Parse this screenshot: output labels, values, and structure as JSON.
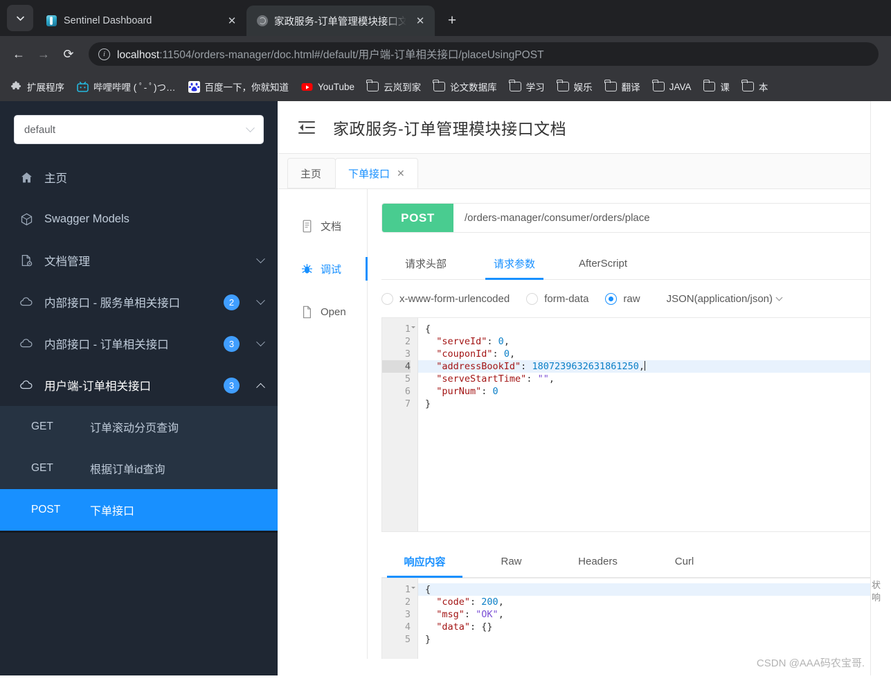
{
  "browser": {
    "tabs": [
      {
        "title": "Sentinel Dashboard",
        "favicon": "sentinel-icon",
        "active": false
      },
      {
        "title": "家政服务-订单管理模块接口文档",
        "favicon": "globe-icon",
        "active": true
      }
    ],
    "new_tab_label": "+",
    "close_label": "✕",
    "nav": {
      "back": "←",
      "forward": "→",
      "reload": "⟳"
    },
    "omnibox": {
      "info_icon_label": "i",
      "url_host": "localhost",
      "url_rest": ":11504/orders-manager/doc.html#/default/用户端-订单相关接口/placeUsingPOST"
    },
    "bookmarks": [
      {
        "label": "扩展程序",
        "icon": "puzzle-icon"
      },
      {
        "label": "哔哩哔哩 ( ﾟ- ﾟ)つ…",
        "icon": "bilibili-icon"
      },
      {
        "label": "百度一下，你就知道",
        "icon": "baidu-icon"
      },
      {
        "label": "YouTube",
        "icon": "youtube-icon"
      },
      {
        "label": "云岚到家",
        "icon": "folder-icon"
      },
      {
        "label": "论文数据库",
        "icon": "folder-icon"
      },
      {
        "label": "学习",
        "icon": "folder-icon"
      },
      {
        "label": "娱乐",
        "icon": "folder-icon"
      },
      {
        "label": "翻译",
        "icon": "folder-icon"
      },
      {
        "label": "JAVA",
        "icon": "folder-icon"
      },
      {
        "label": "课",
        "icon": "folder-icon"
      },
      {
        "label": "本",
        "icon": "folder-icon"
      }
    ]
  },
  "sidebar": {
    "selector_value": "default",
    "menu": [
      {
        "label": "主页",
        "icon": "home-icon",
        "badge": "",
        "arrow": ""
      },
      {
        "label": "Swagger Models",
        "icon": "cube-icon",
        "badge": "",
        "arrow": ""
      },
      {
        "label": "文档管理",
        "icon": "doc-gear-icon",
        "badge": "",
        "arrow": "down"
      },
      {
        "label": "内部接口 - 服务单相关接口",
        "icon": "cloud-icon",
        "badge": "2",
        "arrow": "down"
      },
      {
        "label": "内部接口 - 订单相关接口",
        "icon": "cloud-icon",
        "badge": "3",
        "arrow": "down"
      },
      {
        "label": "用户端-订单相关接口",
        "icon": "cloud-icon",
        "badge": "3",
        "arrow": "up"
      }
    ],
    "submenu": [
      {
        "method": "GET",
        "label": "订单滚动分页查询",
        "active": false
      },
      {
        "method": "GET",
        "label": "根据订单id查询",
        "active": false
      },
      {
        "method": "POST",
        "label": "下单接口",
        "active": true
      }
    ]
  },
  "doc": {
    "title": "家政服务-订单管理模块接口文档",
    "collapse_icon": "collapse-menu-icon",
    "page_tabs": [
      {
        "label": "主页",
        "closable": false,
        "active": false
      },
      {
        "label": "下单接口",
        "closable": true,
        "active": true
      }
    ],
    "close_glyph": "✕",
    "vtabs": [
      {
        "label": "文档",
        "icon": "document-icon",
        "active": false
      },
      {
        "label": "调试",
        "icon": "bug-icon",
        "active": true
      },
      {
        "label": "Open",
        "icon": "file-icon",
        "active": false
      }
    ],
    "request": {
      "method": "POST",
      "url": "/orders-manager/consumer/orders/place",
      "sub_tabs": [
        {
          "label": "请求头部",
          "active": false
        },
        {
          "label": "请求参数",
          "active": true
        },
        {
          "label": "AfterScript",
          "active": false
        }
      ],
      "body_types": [
        {
          "label": "x-www-form-urlencoded",
          "selected": false
        },
        {
          "label": "form-data",
          "selected": false
        },
        {
          "label": "raw",
          "selected": true
        }
      ],
      "content_type": "JSON(application/json)",
      "editor_lines": [
        {
          "no": "1",
          "fold": true,
          "current": false,
          "highlight": false,
          "tokens": [
            {
              "t": "{",
              "c": "pun"
            }
          ]
        },
        {
          "no": "2",
          "fold": false,
          "current": false,
          "highlight": false,
          "tokens": [
            {
              "t": "  \"serveId\"",
              "c": "k"
            },
            {
              "t": ": ",
              "c": "pun"
            },
            {
              "t": "0",
              "c": "num"
            },
            {
              "t": ",",
              "c": "pun"
            }
          ]
        },
        {
          "no": "3",
          "fold": false,
          "current": false,
          "highlight": false,
          "tokens": [
            {
              "t": "  \"couponId\"",
              "c": "k"
            },
            {
              "t": ": ",
              "c": "pun"
            },
            {
              "t": "0",
              "c": "num"
            },
            {
              "t": ",",
              "c": "pun"
            }
          ]
        },
        {
          "no": "4",
          "fold": false,
          "current": true,
          "highlight": true,
          "tokens": [
            {
              "t": "  \"addressBookId\"",
              "c": "k"
            },
            {
              "t": ": ",
              "c": "pun"
            },
            {
              "t": "1807239632631861250",
              "c": "num"
            },
            {
              "t": ",",
              "c": "pun"
            }
          ]
        },
        {
          "no": "5",
          "fold": false,
          "current": false,
          "highlight": false,
          "tokens": [
            {
              "t": "  \"serveStartTime\"",
              "c": "k"
            },
            {
              "t": ": ",
              "c": "pun"
            },
            {
              "t": "\"\"",
              "c": "str"
            },
            {
              "t": ",",
              "c": "pun"
            }
          ]
        },
        {
          "no": "6",
          "fold": false,
          "current": false,
          "highlight": false,
          "tokens": [
            {
              "t": "  \"purNum\"",
              "c": "k"
            },
            {
              "t": ": ",
              "c": "pun"
            },
            {
              "t": "0",
              "c": "num"
            }
          ]
        },
        {
          "no": "7",
          "fold": false,
          "current": false,
          "highlight": false,
          "tokens": [
            {
              "t": "}",
              "c": "pun"
            }
          ]
        }
      ]
    },
    "response": {
      "tabs": [
        {
          "label": "响应内容",
          "active": true
        },
        {
          "label": "Raw",
          "active": false
        },
        {
          "label": "Headers",
          "active": false
        },
        {
          "label": "Curl",
          "active": false
        }
      ],
      "editor_lines": [
        {
          "no": "1",
          "fold": true,
          "current": false,
          "highlight": true,
          "tokens": [
            {
              "t": "{",
              "c": "pun"
            }
          ]
        },
        {
          "no": "2",
          "fold": false,
          "current": false,
          "highlight": false,
          "tokens": [
            {
              "t": "  \"code\"",
              "c": "k"
            },
            {
              "t": ": ",
              "c": "pun"
            },
            {
              "t": "200",
              "c": "num"
            },
            {
              "t": ",",
              "c": "pun"
            }
          ]
        },
        {
          "no": "3",
          "fold": false,
          "current": false,
          "highlight": false,
          "tokens": [
            {
              "t": "  \"msg\"",
              "c": "k"
            },
            {
              "t": ": ",
              "c": "pun"
            },
            {
              "t": "\"OK\"",
              "c": "str"
            },
            {
              "t": ",",
              "c": "pun"
            }
          ]
        },
        {
          "no": "4",
          "fold": false,
          "current": false,
          "highlight": false,
          "tokens": [
            {
              "t": "  \"data\"",
              "c": "k"
            },
            {
              "t": ": ",
              "c": "pun"
            },
            {
              "t": "{}",
              "c": "pun"
            }
          ]
        },
        {
          "no": "5",
          "fold": false,
          "current": false,
          "highlight": false,
          "tokens": [
            {
              "t": "}",
              "c": "pun"
            }
          ]
        }
      ]
    },
    "clipped_right_text": "状\n响"
  },
  "watermark": "CSDN @AAA码农宝哥."
}
